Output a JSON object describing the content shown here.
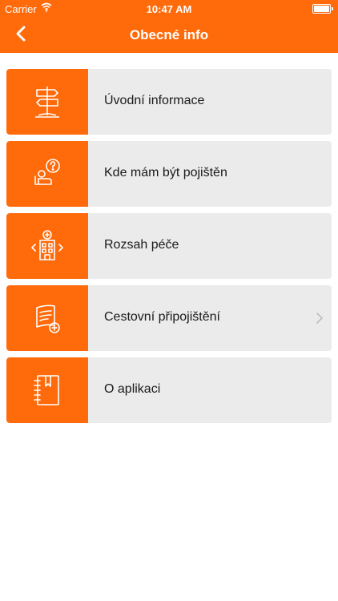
{
  "status_bar": {
    "carrier": "Carrier",
    "time": "10:47 AM"
  },
  "nav": {
    "title": "Obecné info"
  },
  "colors": {
    "accent": "#FF6A0A",
    "row_background": "#EBEBEB"
  },
  "menu": {
    "items": [
      {
        "label": "Úvodní informace",
        "icon": "signpost-icon"
      },
      {
        "label": "Kde mám být pojištěn",
        "icon": "person-question-icon"
      },
      {
        "label": "Rozsah péče",
        "icon": "hospital-icon"
      },
      {
        "label": "Cestovní připojištění",
        "icon": "travel-card-plus-icon",
        "has_chevron": true
      },
      {
        "label": "O aplikaci",
        "icon": "notebook-icon"
      }
    ]
  }
}
